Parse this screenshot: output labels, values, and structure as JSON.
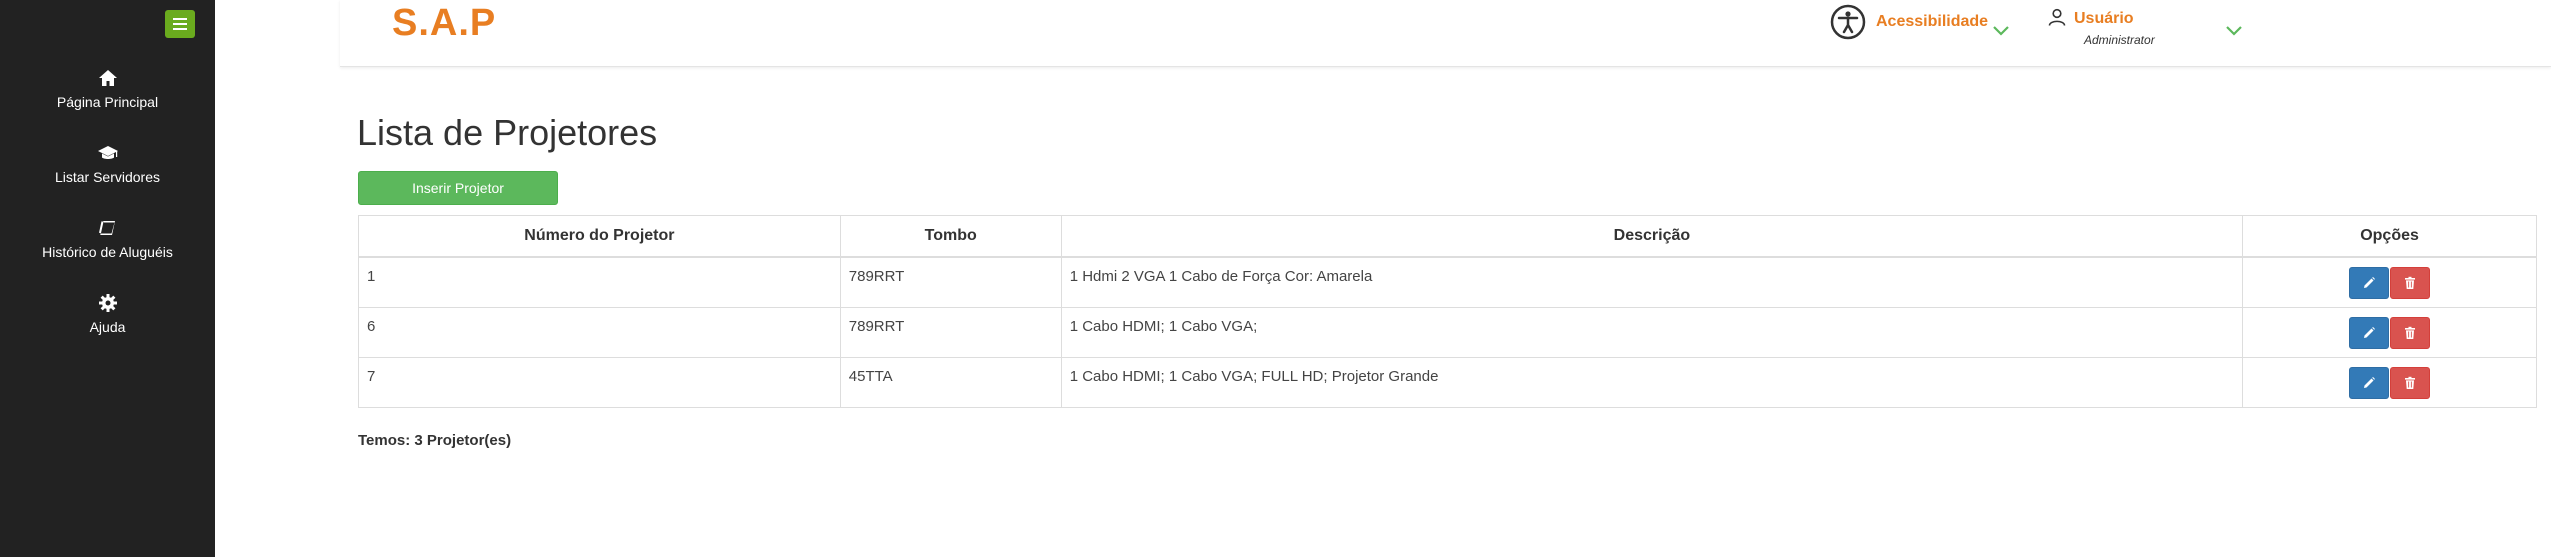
{
  "app": {
    "brand": "S.A.P"
  },
  "sidebar": {
    "items": [
      {
        "label": "Página Principal",
        "icon": "home-icon"
      },
      {
        "label": "Listar Servidores",
        "icon": "graduation-cap-icon"
      },
      {
        "label": "Histórico de Aluguéis",
        "icon": "book-icon"
      },
      {
        "label": "Ajuda",
        "icon": "gear-icon"
      }
    ]
  },
  "header": {
    "accessibility_label": "Acessibilidade",
    "user_label": "Usuário",
    "user_role": "Administrator"
  },
  "main": {
    "title": "Lista de Projetores",
    "insert_button": "Inserir Projetor",
    "columns": [
      "Número do Projetor",
      "Tombo",
      "Descrição",
      "Opções"
    ],
    "rows": [
      {
        "numero": "1",
        "tombo": "789RRT",
        "descricao": "1 Hdmi 2 VGA 1 Cabo de Força Cor: Amarela"
      },
      {
        "numero": "6",
        "tombo": "789RRT",
        "descricao": "1 Cabo HDMI; 1 Cabo VGA;"
      },
      {
        "numero": "7",
        "tombo": "45TTA",
        "descricao": "1 Cabo HDMI; 1 Cabo VGA; FULL HD; Projetor Grande"
      }
    ],
    "total": "Temos: 3 Projetor(es)"
  },
  "colors": {
    "brand": "#e87e22",
    "sidebar_bg": "#222222",
    "toggle": "#6aab1e",
    "insert_btn": "#5cb85c",
    "edit_btn": "#337ab7",
    "delete_btn": "#d9534f",
    "chevron": "#5cb85c"
  }
}
